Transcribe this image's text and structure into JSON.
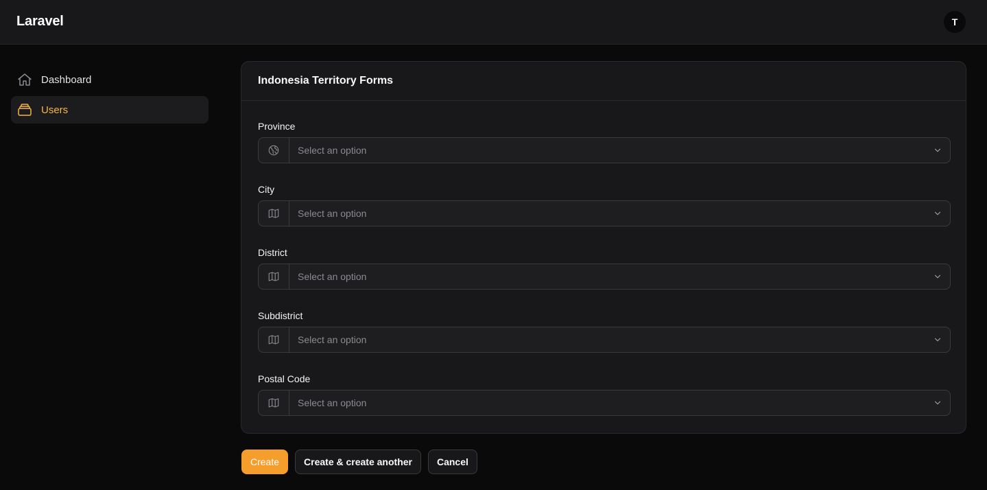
{
  "header": {
    "brand": "Laravel",
    "avatar_initial": "T"
  },
  "sidebar": {
    "items": [
      {
        "label": "Dashboard",
        "icon": "home-icon",
        "active": false
      },
      {
        "label": "Users",
        "icon": "stack-icon",
        "active": true
      }
    ]
  },
  "form": {
    "title": "Indonesia Territory Forms",
    "fields": [
      {
        "label": "Province",
        "placeholder": "Select an option",
        "icon": "globe-icon"
      },
      {
        "label": "City",
        "placeholder": "Select an option",
        "icon": "map-icon"
      },
      {
        "label": "District",
        "placeholder": "Select an option",
        "icon": "map-icon"
      },
      {
        "label": "Subdistrict",
        "placeholder": "Select an option",
        "icon": "map-icon"
      },
      {
        "label": "Postal Code",
        "placeholder": "Select an option",
        "icon": "map-icon"
      }
    ]
  },
  "actions": {
    "create": "Create",
    "create_another": "Create & create another",
    "cancel": "Cancel"
  },
  "colors": {
    "accent": "#f59e2c",
    "active_text": "#f5b742",
    "background": "#0a0a0b",
    "surface": "#18181b"
  }
}
